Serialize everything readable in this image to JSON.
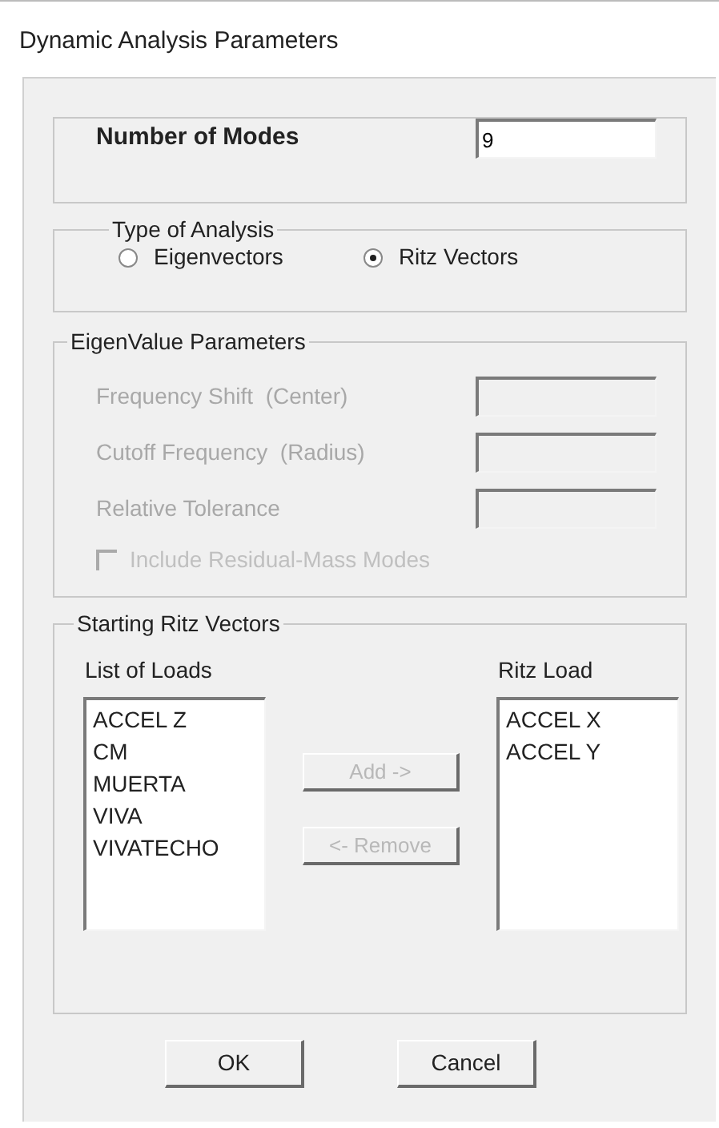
{
  "window": {
    "title": "Dynamic Analysis Parameters"
  },
  "number_of_modes": {
    "label": "Number of Modes",
    "value": "9"
  },
  "type_of_analysis": {
    "title": "Type of Analysis",
    "options": [
      {
        "label": "Eigenvectors",
        "selected": false
      },
      {
        "label": "Ritz Vectors",
        "selected": true
      }
    ]
  },
  "eigenvalue_parameters": {
    "title": "EigenValue Parameters",
    "disabled": true,
    "fields": [
      {
        "label": "Frequency Shift  (Center)"
      },
      {
        "label": "Cutoff Frequency  (Radius)"
      },
      {
        "label": "Relative Tolerance"
      }
    ],
    "include_residual_mass_modes": {
      "label": "Include Residual-Mass Modes",
      "checked": false
    }
  },
  "starting_ritz_vectors": {
    "title": "Starting Ritz Vectors",
    "list_of_loads": {
      "title": "List of Loads",
      "items": [
        "ACCEL Z",
        "CM",
        "MUERTA",
        "VIVA",
        "VIVATECHO"
      ]
    },
    "ritz_load": {
      "title": "Ritz Load",
      "items": [
        "ACCEL X",
        "ACCEL Y"
      ]
    },
    "buttons": [
      {
        "label": "Add ->",
        "disabled": true
      },
      {
        "label": "<- Remove",
        "disabled": true
      }
    ]
  },
  "buttons": [
    {
      "label": "OK"
    },
    {
      "label": "Cancel"
    }
  ]
}
